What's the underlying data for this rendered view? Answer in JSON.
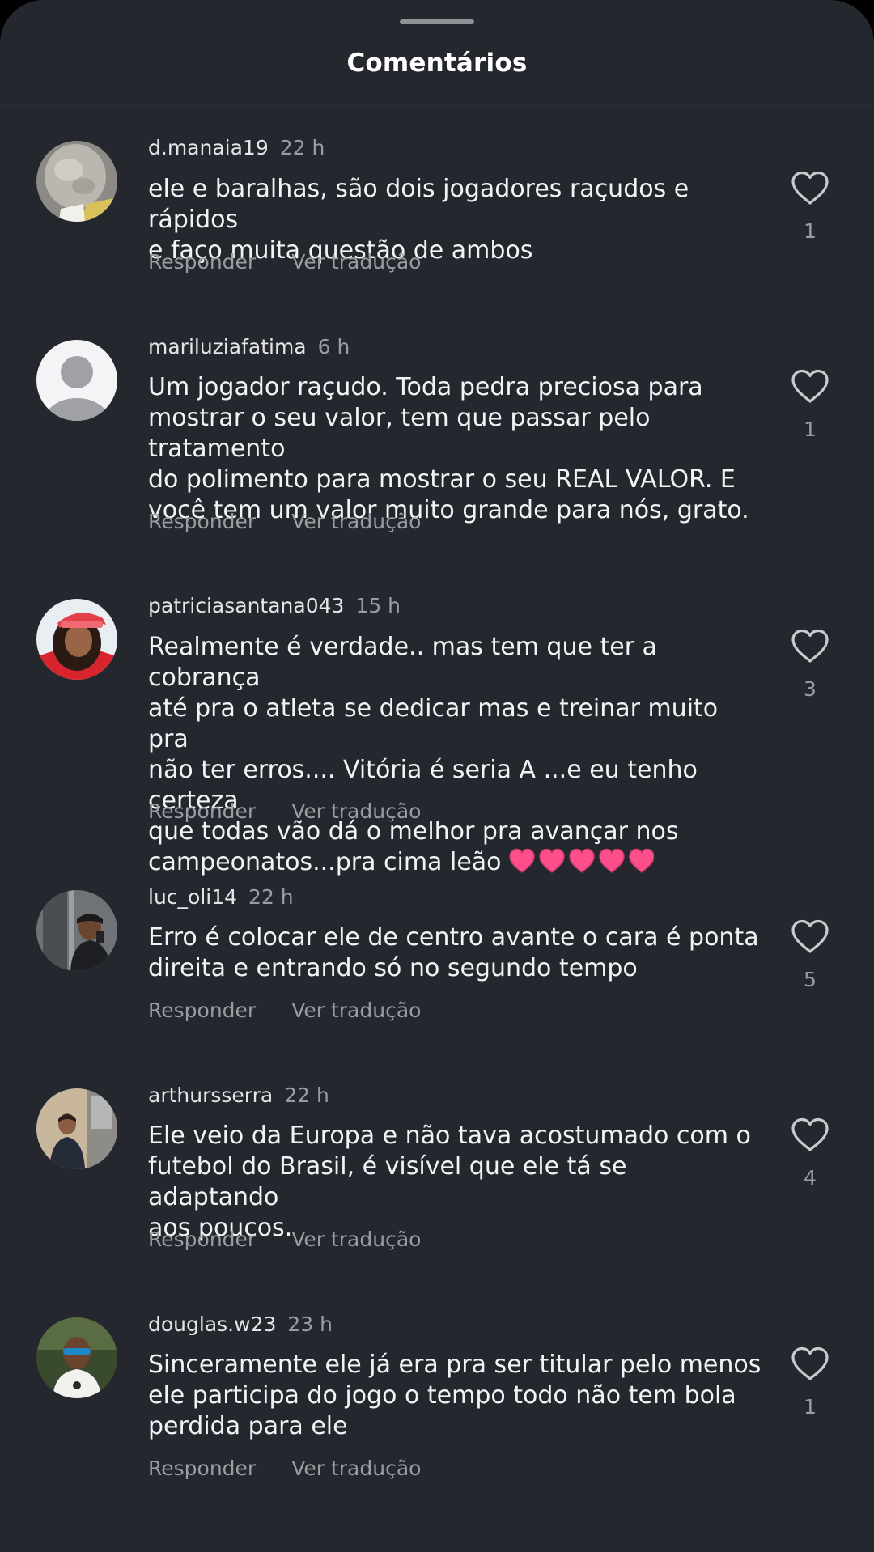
{
  "header": {
    "title": "Comentários"
  },
  "actions": {
    "reply_label": "Responder",
    "translate_label": "Ver tradução"
  },
  "comments": [
    {
      "username": "d.manaia19",
      "time": "22 h",
      "text": "ele e baralhas, são dois jogadores raçudos e rápidos\ne faço muita questão de ambos",
      "likes": "1",
      "avatar": "stone-photo"
    },
    {
      "username": "mariluziafatima",
      "time": "6 h",
      "text": "Um jogador raçudo. Toda pedra preciosa para\nmostrar o seu valor, tem que passar pelo tratamento\ndo polimento para mostrar o seu REAL VALOR. E\nvocê tem um valor muito grande para nós, grato.",
      "likes": "1",
      "avatar": "default-user"
    },
    {
      "username": "patriciasantana043",
      "time": "15 h",
      "text": "Realmente é verdade.. mas tem que ter a cobrança\naté pra o atleta se dedicar mas e  treinar muito pra\nnão ter erros.... Vitória é seria A ...e eu tenho certeza\nque todas vão dá o melhor pra avançar nos\ncampeonatos...pra cima leão",
      "emoji": "5 pink hearts",
      "likes": "3",
      "avatar": "woman-red-cap-photo"
    },
    {
      "username": "luc_oli14",
      "time": "22 h",
      "text": "Erro é colocar ele de centro avante o cara é ponta\ndireita e entrando só no segundo tempo",
      "likes": "5",
      "avatar": "mirror-selfie-photo"
    },
    {
      "username": "arthursserra",
      "time": "22 h",
      "text": "Ele veio da Europa e não tava acostumado com o\nfutebol do Brasil, é visível que ele tá se adaptando\naos poucos.",
      "likes": "4",
      "avatar": "man-indoor-photo"
    },
    {
      "username": "douglas.w23",
      "time": "23 h",
      "text": "Sinceramente ele já era pra ser titular pelo menos\nele participa do jogo o tempo todo não tem bola\nperdida para ele",
      "likes": "1",
      "avatar": "man-sunglasses-photo"
    }
  ],
  "colors": {
    "background": "#25272e",
    "text": "#f2f3f5",
    "muted": "#9a9ca2",
    "heart_emoji": "#ff4f8b"
  }
}
